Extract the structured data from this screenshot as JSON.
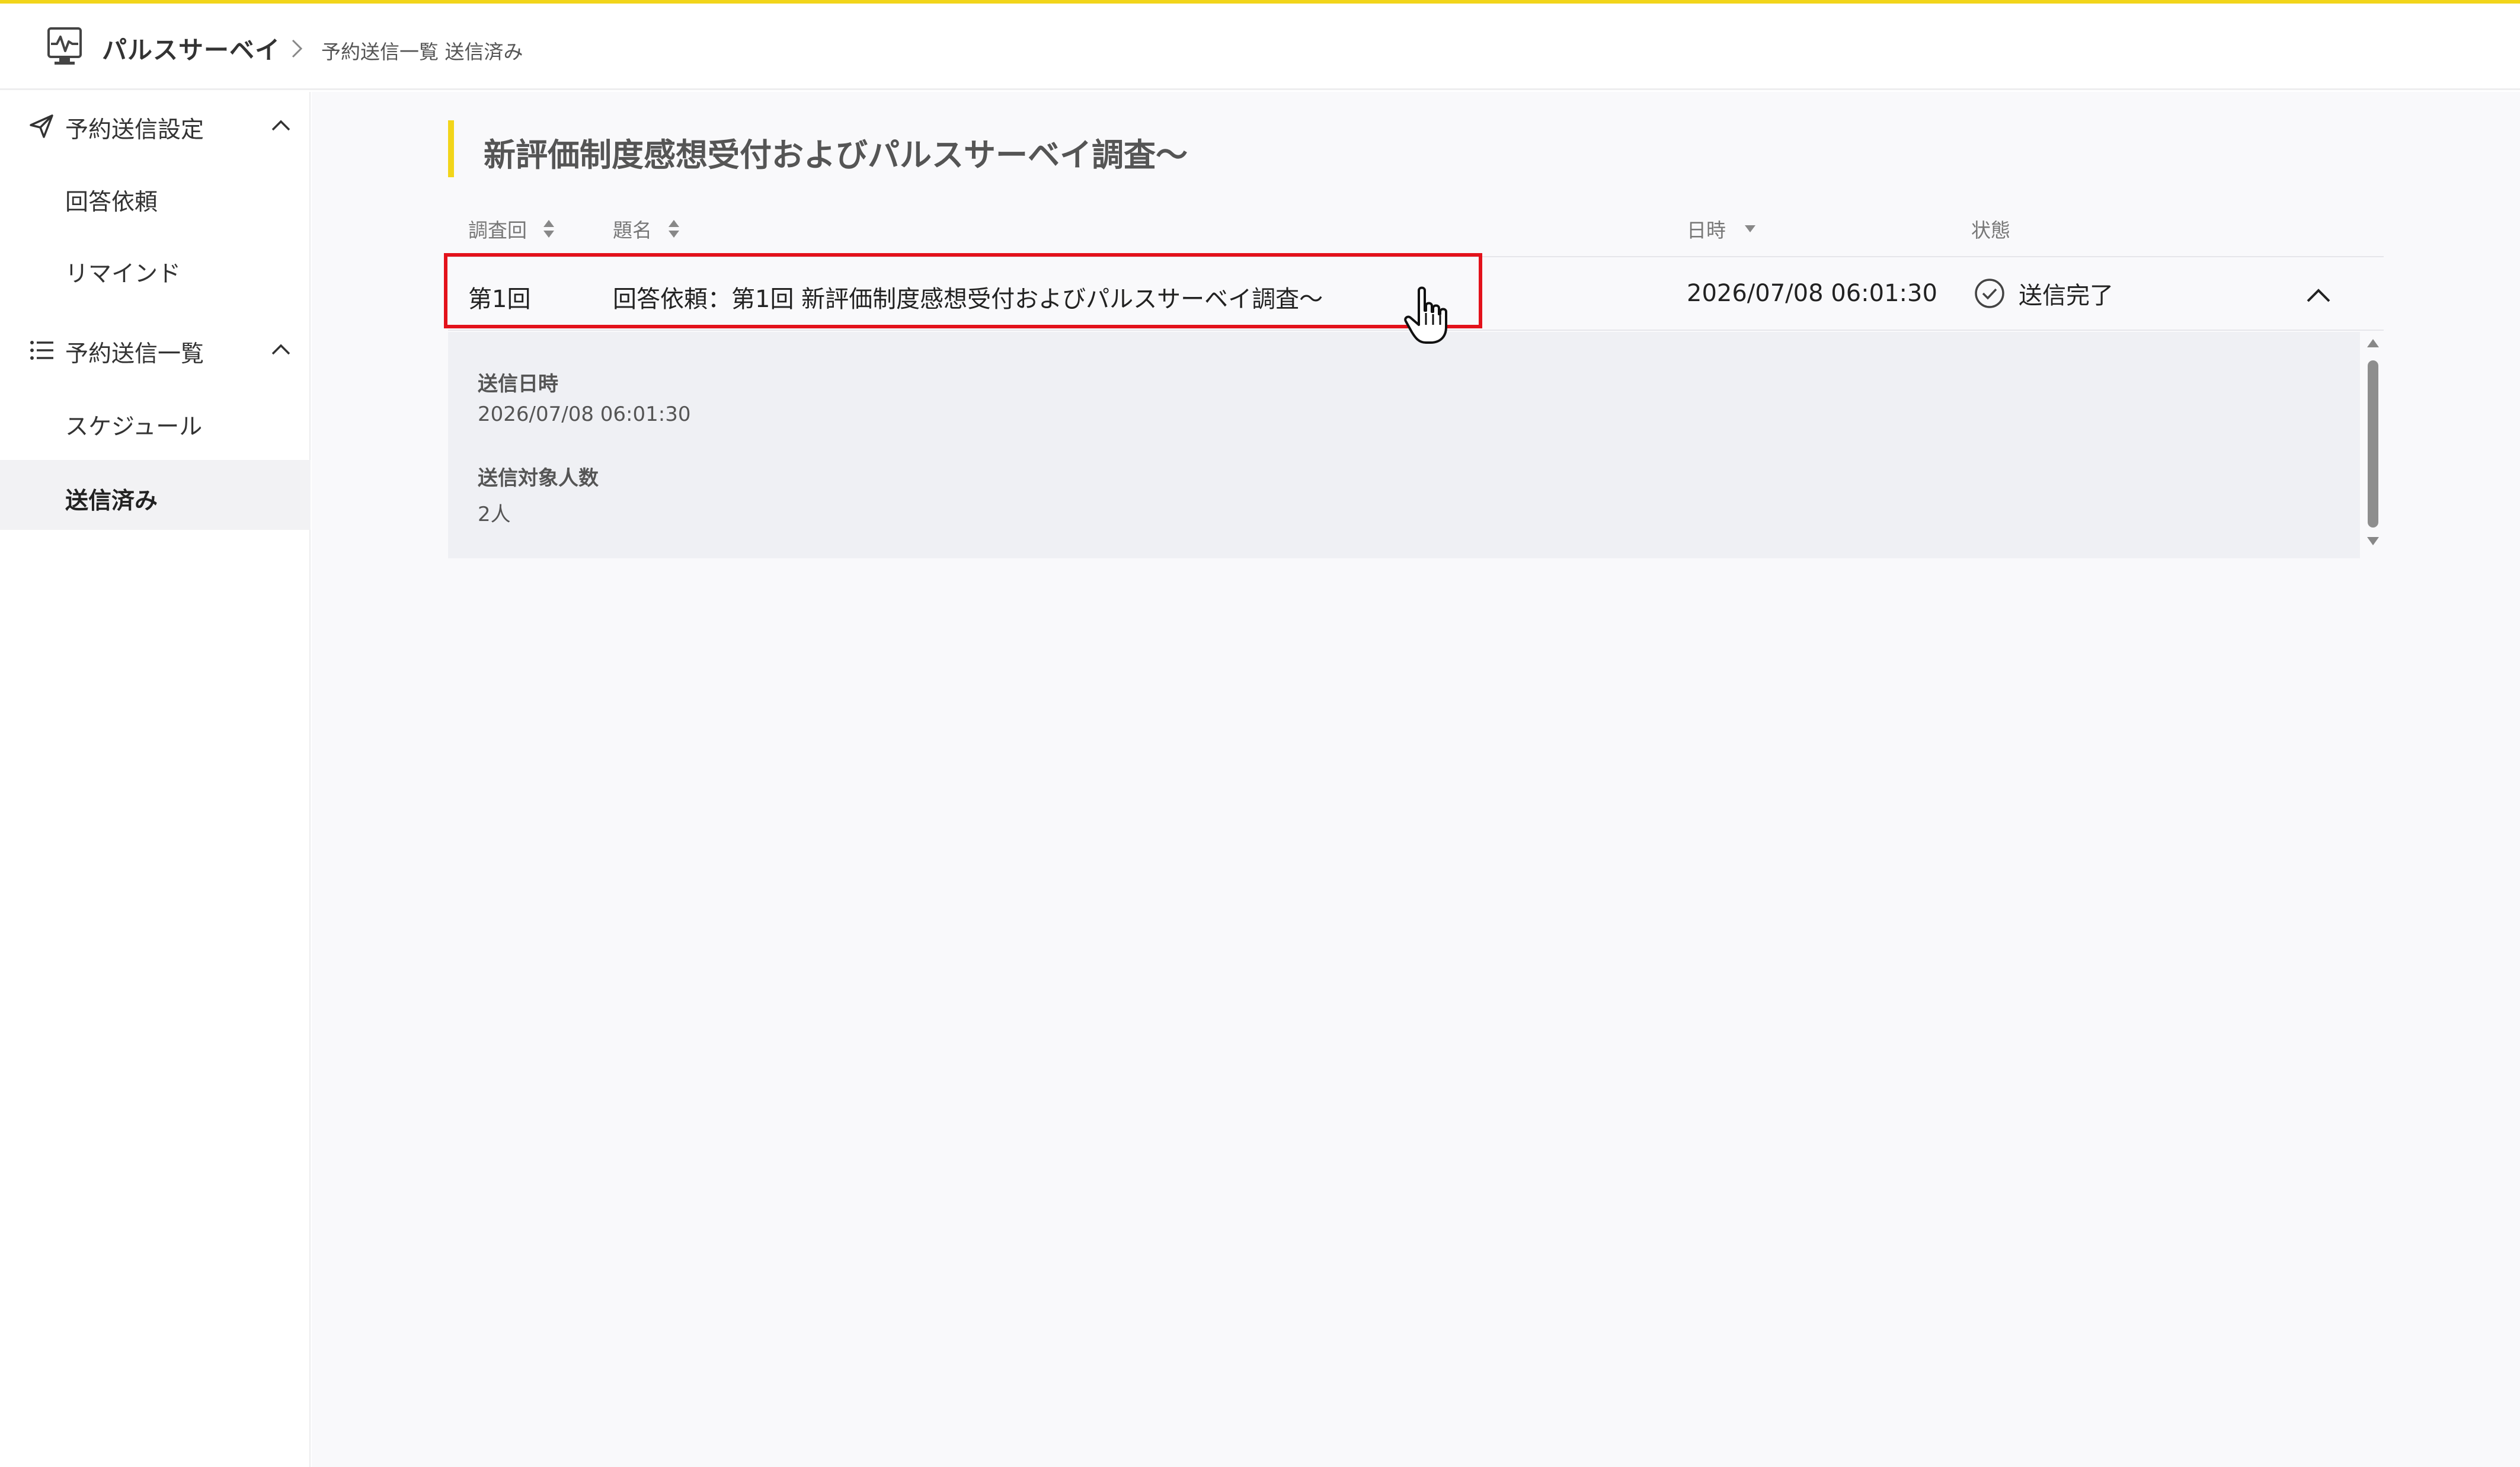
{
  "header": {
    "app_name": "パルスサーベイ",
    "breadcrumb": "予約送信一覧 送信済み"
  },
  "sidebar": {
    "groups": [
      {
        "label": "予約送信設定",
        "icon": "paper-plane-icon",
        "items": [
          {
            "label": "回答依頼"
          },
          {
            "label": "リマインド"
          }
        ]
      },
      {
        "label": "予約送信一覧",
        "icon": "list-icon",
        "items": [
          {
            "label": "スケジュール"
          },
          {
            "label": "送信済み"
          }
        ]
      }
    ]
  },
  "main": {
    "title": "新評価制度感想受付およびパルスサーベイ調査〜",
    "table": {
      "columns": [
        "調査回",
        "題名",
        "日時",
        "状態"
      ],
      "rows": [
        {
          "round": "第1回",
          "subject": "回答依頼：第1回 新評価制度感想受付およびパルスサーベイ調査〜",
          "datetime": "2026/07/08 06:01:30",
          "status": "送信完了"
        }
      ]
    },
    "detail": {
      "sent_at_label": "送信日時",
      "sent_at_value": "2026/07/08 06:01:30",
      "recipients_label": "送信対象人数",
      "recipients_value": "2人"
    }
  },
  "colors": {
    "accent": "#f2d51a",
    "highlight": "#e3121b"
  }
}
